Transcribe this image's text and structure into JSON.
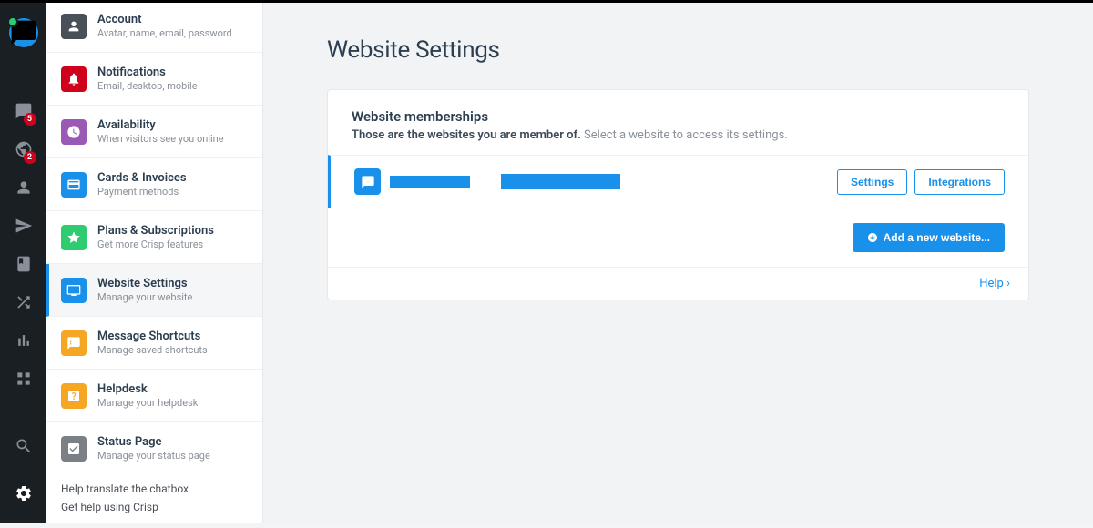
{
  "rail": {
    "badges": {
      "inbox": "5",
      "visitors": "2"
    }
  },
  "sidebar": {
    "items": [
      {
        "title": "Account",
        "sub": "Avatar, name, email, password",
        "color": "#4a5057"
      },
      {
        "title": "Notifications",
        "sub": "Email, desktop, mobile",
        "color": "#d0021b"
      },
      {
        "title": "Availability",
        "sub": "When visitors see you online",
        "color": "#9b59b6"
      },
      {
        "title": "Cards & Invoices",
        "sub": "Payment methods",
        "color": "#1991eb"
      },
      {
        "title": "Plans & Subscriptions",
        "sub": "Get more Crisp features",
        "color": "#2ecc71"
      },
      {
        "title": "Website Settings",
        "sub": "Manage your website",
        "color": "#1991eb"
      },
      {
        "title": "Message Shortcuts",
        "sub": "Manage saved shortcuts",
        "color": "#f5a623"
      },
      {
        "title": "Helpdesk",
        "sub": "Manage your helpdesk",
        "color": "#f5a623"
      },
      {
        "title": "Status Page",
        "sub": "Manage your status page",
        "color": "#7b8087"
      }
    ],
    "footer": {
      "translate": "Help translate the chatbox",
      "help": "Get help using Crisp"
    }
  },
  "main": {
    "title": "Website Settings",
    "memberships": {
      "heading": "Website memberships",
      "desc_bold": "Those are the websites you are member of.",
      "desc_light": "Select a website to access its settings.",
      "settings_label": "Settings",
      "integrations_label": "Integrations",
      "add_label": "Add a new website...",
      "help_label": "Help"
    }
  }
}
